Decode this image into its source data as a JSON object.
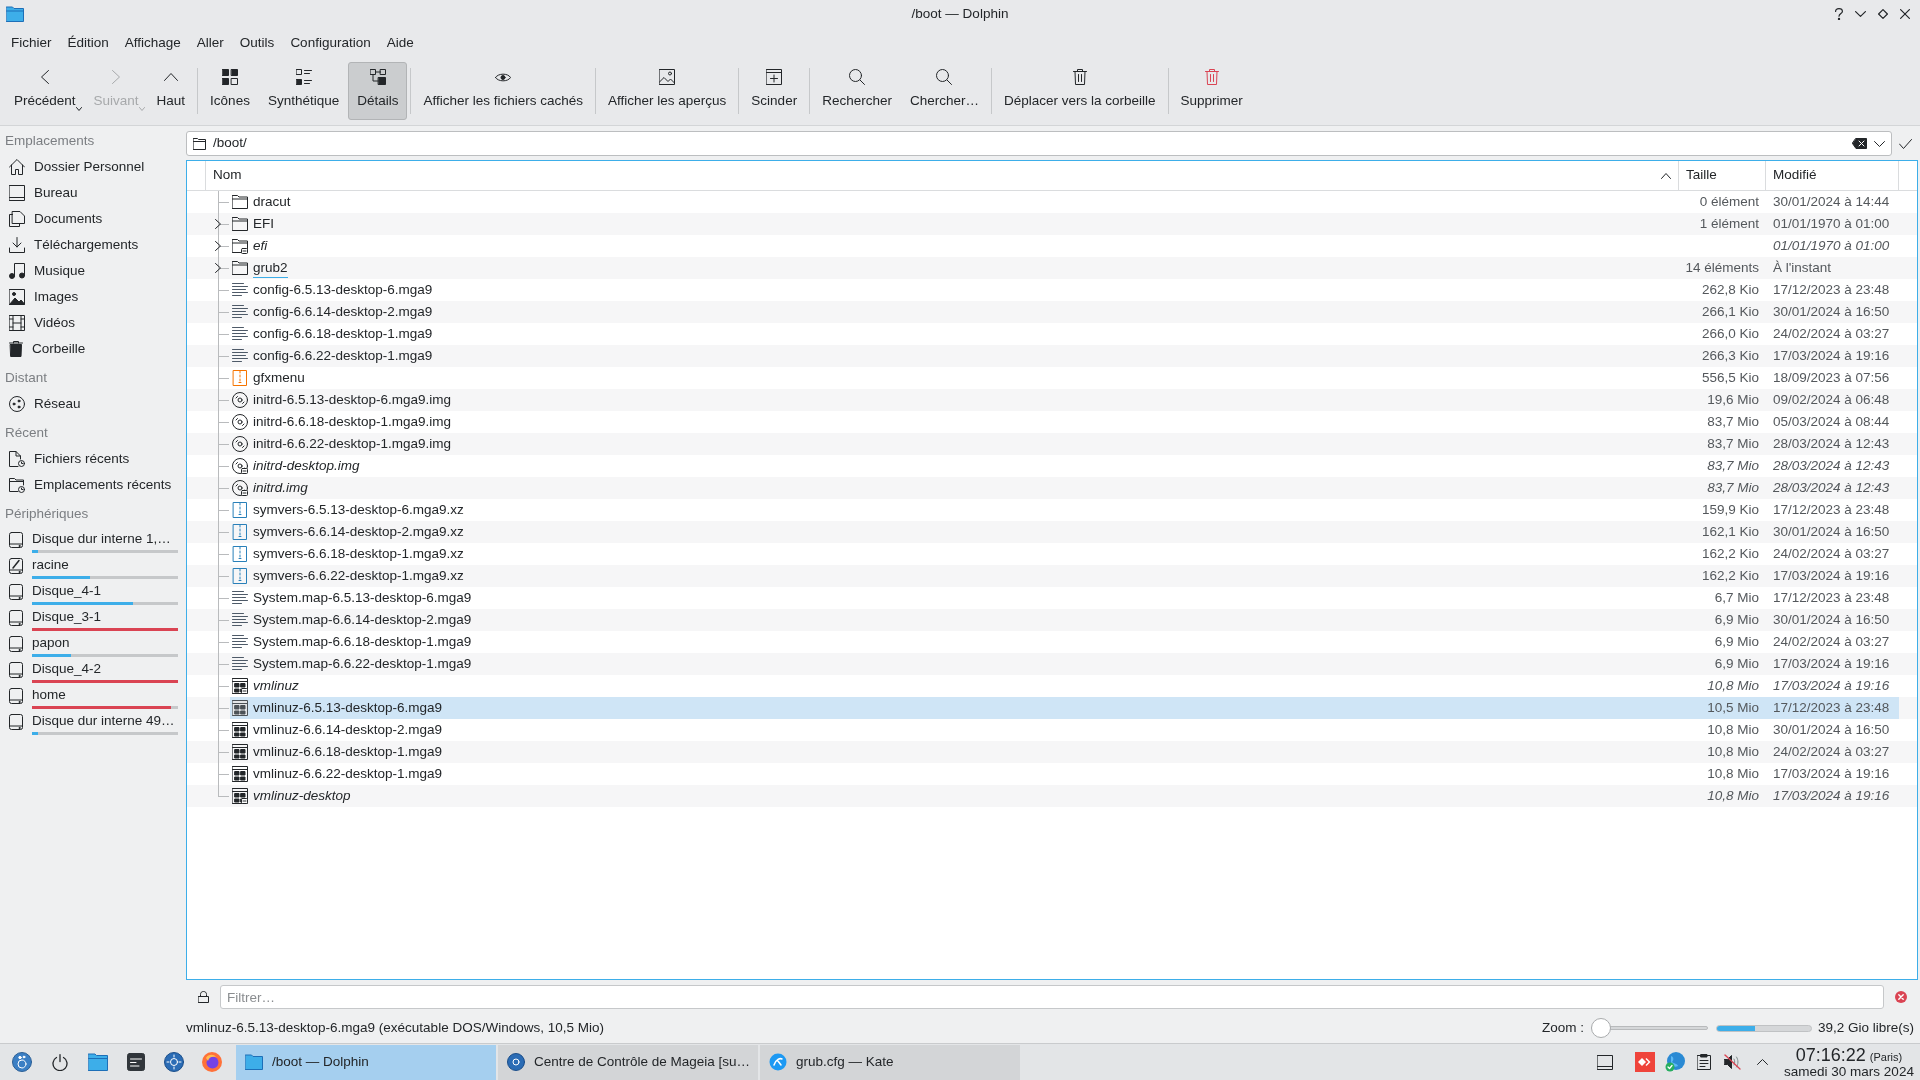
{
  "window": {
    "title": "/boot — Dolphin"
  },
  "menu": [
    "Fichier",
    "Édition",
    "Affichage",
    "Aller",
    "Outils",
    "Configuration",
    "Aide"
  ],
  "toolbar": {
    "groups": [
      [
        {
          "label": "Précédent",
          "selected": false,
          "disabled": false,
          "menu": true
        },
        {
          "label": "Suivant",
          "selected": false,
          "disabled": true,
          "menu": true
        },
        {
          "label": "Haut",
          "selected": false,
          "disabled": false,
          "menu": false
        }
      ],
      [
        {
          "label": "Icônes",
          "selected": false,
          "disabled": false,
          "menu": false
        },
        {
          "label": "Synthétique",
          "selected": false,
          "disabled": false,
          "menu": false
        },
        {
          "label": "Détails",
          "selected": true,
          "disabled": false,
          "menu": false
        }
      ],
      [
        {
          "label": "Afficher les fichiers cachés",
          "selected": false,
          "disabled": false,
          "menu": false
        }
      ],
      [
        {
          "label": "Afficher les aperçus",
          "selected": false,
          "disabled": false,
          "menu": false
        }
      ],
      [
        {
          "label": "Scinder",
          "selected": false,
          "disabled": false,
          "menu": false
        }
      ],
      [
        {
          "label": "Rechercher",
          "selected": false,
          "disabled": false,
          "menu": false
        },
        {
          "label": "Chercher…",
          "selected": false,
          "disabled": false,
          "menu": false
        }
      ],
      [
        {
          "label": "Déplacer vers la corbeille",
          "selected": false,
          "disabled": false,
          "menu": false
        }
      ],
      [
        {
          "label": "Supprimer",
          "selected": false,
          "disabled": false,
          "menu": false
        }
      ]
    ]
  },
  "sidebar": {
    "sections": [
      {
        "title": "Emplacements",
        "items": [
          {
            "label": "Dossier Personnel"
          },
          {
            "label": "Bureau"
          },
          {
            "label": "Documents"
          },
          {
            "label": "Téléchargements"
          },
          {
            "label": "Musique"
          },
          {
            "label": "Images"
          },
          {
            "label": "Vidéos"
          },
          {
            "label": "Corbeille"
          }
        ]
      },
      {
        "title": "Distant",
        "items": [
          {
            "label": "Réseau"
          }
        ]
      },
      {
        "title": "Récent",
        "items": [
          {
            "label": "Fichiers récents"
          },
          {
            "label": "Emplacements récents"
          }
        ]
      },
      {
        "title": "Périphériques",
        "items": [
          {
            "label": "Disque dur interne 1,…",
            "level": 0.04,
            "color": "#3daee9"
          },
          {
            "label": "racine",
            "level": 0.4,
            "color": "#3daee9"
          },
          {
            "label": "Disque_4-1",
            "level": 0.69,
            "color": "#3daee9"
          },
          {
            "label": "Disque_3-1",
            "level": 1,
            "color": "#da4453"
          },
          {
            "label": "papon",
            "level": 0.27,
            "color": "#3daee9"
          },
          {
            "label": "Disque_4-2",
            "level": 1,
            "color": "#da4453"
          },
          {
            "label": "home",
            "level": 0.95,
            "color": "#da4453"
          },
          {
            "label": "Disque dur interne 49…",
            "level": 0.04,
            "color": "#3daee9"
          }
        ]
      }
    ]
  },
  "location": {
    "path": "/boot/"
  },
  "file_view": {
    "columns": [
      {
        "label": "Nom",
        "sorted": true
      },
      {
        "label": "Taille",
        "sorted": false
      },
      {
        "label": "Modifié",
        "sorted": false
      }
    ],
    "rows": [
      {
        "name": "dracut",
        "kind": "folder",
        "size": "0 élément",
        "modified": "30/01/2024 à 14:44",
        "link": false,
        "expandable": false,
        "selected": false,
        "focused": false
      },
      {
        "name": "EFI",
        "kind": "folder",
        "size": "1 élément",
        "modified": "01/01/1970 à 01:00",
        "link": false,
        "expandable": true,
        "selected": false,
        "focused": false
      },
      {
        "name": "efi",
        "kind": "folder",
        "modified": "01/01/1970 à 01:00",
        "link": true,
        "expandable": true,
        "selected": false,
        "focused": false
      },
      {
        "name": "grub2",
        "kind": "folder",
        "size": "14 éléments",
        "modified": "À l'instant",
        "link": false,
        "expandable": true,
        "selected": false,
        "focused": true
      },
      {
        "name": "config-6.5.13-desktop-6.mga9",
        "kind": "text",
        "size": "262,8 Kio",
        "modified": "17/12/2023 à 23:48",
        "link": false,
        "expandable": false,
        "selected": false,
        "focused": false
      },
      {
        "name": "config-6.6.14-desktop-2.mga9",
        "kind": "text",
        "size": "266,1 Kio",
        "modified": "30/01/2024 à 16:50",
        "link": false,
        "expandable": false,
        "selected": false,
        "focused": false
      },
      {
        "name": "config-6.6.18-desktop-1.mga9",
        "kind": "text",
        "size": "266,0 Kio",
        "modified": "24/02/2024 à 03:27",
        "link": false,
        "expandable": false,
        "selected": false,
        "focused": false
      },
      {
        "name": "config-6.6.22-desktop-1.mga9",
        "kind": "text",
        "size": "266,3 Kio",
        "modified": "17/03/2024 à 19:16",
        "link": false,
        "expandable": false,
        "selected": false,
        "focused": false
      },
      {
        "name": "gfxmenu",
        "kind": "package",
        "size": "556,5 Kio",
        "modified": "18/09/2023 à 07:56",
        "link": false,
        "expandable": false,
        "selected": false,
        "focused": false
      },
      {
        "name": "initrd-6.5.13-desktop-6.mga9.img",
        "kind": "disc",
        "size": "19,6 Mio",
        "modified": "09/02/2024 à 06:48",
        "link": false,
        "expandable": false,
        "selected": false,
        "focused": false
      },
      {
        "name": "initrd-6.6.18-desktop-1.mga9.img",
        "kind": "disc",
        "size": "83,7 Mio",
        "modified": "05/03/2024 à 08:44",
        "link": false,
        "expandable": false,
        "selected": false,
        "focused": false
      },
      {
        "name": "initrd-6.6.22-desktop-1.mga9.img",
        "kind": "disc",
        "size": "83,7 Mio",
        "modified": "28/03/2024 à 12:43",
        "link": false,
        "expandable": false,
        "selected": false,
        "focused": false
      },
      {
        "name": "initrd-desktop.img",
        "kind": "disc",
        "size": "83,7 Mio",
        "modified": "28/03/2024 à 12:43",
        "link": true,
        "expandable": false,
        "selected": false,
        "focused": false
      },
      {
        "name": "initrd.img",
        "kind": "disc",
        "size": "83,7 Mio",
        "modified": "28/03/2024 à 12:43",
        "link": true,
        "expandable": false,
        "selected": false,
        "focused": false
      },
      {
        "name": "symvers-6.5.13-desktop-6.mga9.xz",
        "kind": "xz",
        "size": "159,9 Kio",
        "modified": "17/12/2023 à 23:48",
        "link": false,
        "expandable": false,
        "selected": false,
        "focused": false
      },
      {
        "name": "symvers-6.6.14-desktop-2.mga9.xz",
        "kind": "xz",
        "size": "162,1 Kio",
        "modified": "30/01/2024 à 16:50",
        "link": false,
        "expandable": false,
        "selected": false,
        "focused": false
      },
      {
        "name": "symvers-6.6.18-desktop-1.mga9.xz",
        "kind": "xz",
        "size": "162,2 Kio",
        "modified": "24/02/2024 à 03:27",
        "link": false,
        "expandable": false,
        "selected": false,
        "focused": false
      },
      {
        "name": "symvers-6.6.22-desktop-1.mga9.xz",
        "kind": "xz",
        "size": "162,2 Kio",
        "modified": "17/03/2024 à 19:16",
        "link": false,
        "expandable": false,
        "selected": false,
        "focused": false
      },
      {
        "name": "System.map-6.5.13-desktop-6.mga9",
        "kind": "text",
        "size": "6,7 Mio",
        "modified": "17/12/2023 à 23:48",
        "link": false,
        "expandable": false,
        "selected": false,
        "focused": false
      },
      {
        "name": "System.map-6.6.14-desktop-2.mga9",
        "kind": "text",
        "size": "6,9 Mio",
        "modified": "30/01/2024 à 16:50",
        "link": false,
        "expandable": false,
        "selected": false,
        "focused": false
      },
      {
        "name": "System.map-6.6.18-desktop-1.mga9",
        "kind": "text",
        "size": "6,9 Mio",
        "modified": "24/02/2024 à 03:27",
        "link": false,
        "expandable": false,
        "selected": false,
        "focused": false
      },
      {
        "name": "System.map-6.6.22-desktop-1.mga9",
        "kind": "text",
        "size": "6,9 Mio",
        "modified": "17/03/2024 à 19:16",
        "link": false,
        "expandable": false,
        "selected": false,
        "focused": false
      },
      {
        "name": "vmlinuz",
        "kind": "binary",
        "size": "10,8 Mio",
        "modified": "17/03/2024 à 19:16",
        "link": true,
        "expandable": false,
        "selected": false,
        "focused": false
      },
      {
        "name": "vmlinuz-6.5.13-desktop-6.mga9",
        "kind": "binary",
        "size": "10,5 Mio",
        "modified": "17/12/2023 à 23:48",
        "link": false,
        "expandable": false,
        "selected": true,
        "focused": false
      },
      {
        "name": "vmlinuz-6.6.14-desktop-2.mga9",
        "kind": "binary",
        "size": "10,8 Mio",
        "modified": "30/01/2024 à 16:50",
        "link": false,
        "expandable": false,
        "selected": false,
        "focused": false
      },
      {
        "name": "vmlinuz-6.6.18-desktop-1.mga9",
        "kind": "binary",
        "size": "10,8 Mio",
        "modified": "24/02/2024 à 03:27",
        "link": false,
        "expandable": false,
        "selected": false,
        "focused": false
      },
      {
        "name": "vmlinuz-6.6.22-desktop-1.mga9",
        "kind": "binary",
        "size": "10,8 Mio",
        "modified": "17/03/2024 à 19:16",
        "link": false,
        "expandable": false,
        "selected": false,
        "focused": false
      },
      {
        "name": "vmlinuz-desktop",
        "kind": "binary",
        "size": "10,8 Mio",
        "modified": "17/03/2024 à 19:16",
        "link": true,
        "expandable": false,
        "selected": false,
        "focused": false
      }
    ]
  },
  "filter": {
    "placeholder": "Filtrer…"
  },
  "status": {
    "text": "vmlinuz-6.5.13-desktop-6.mga9 (exécutable DOS/Windows, 10,5 Mio)",
    "zoom_label": "Zoom :",
    "zoom": {
      "level": 0
    },
    "free_space": {
      "level": 0.4,
      "label": "39,2 Gio libre(s)"
    }
  },
  "taskbar": {
    "tasks": [
      {
        "label": "/boot — Dolphin",
        "selected": true
      },
      {
        "label": "Centre de Contrôle de Mageia [su…",
        "selected": false
      },
      {
        "label": "grub.cfg — Kate",
        "selected": false
      }
    ],
    "clock": {
      "time": "07:16:22",
      "zone": "(Paris)",
      "date": "samedi 30 mars 2024"
    }
  }
}
